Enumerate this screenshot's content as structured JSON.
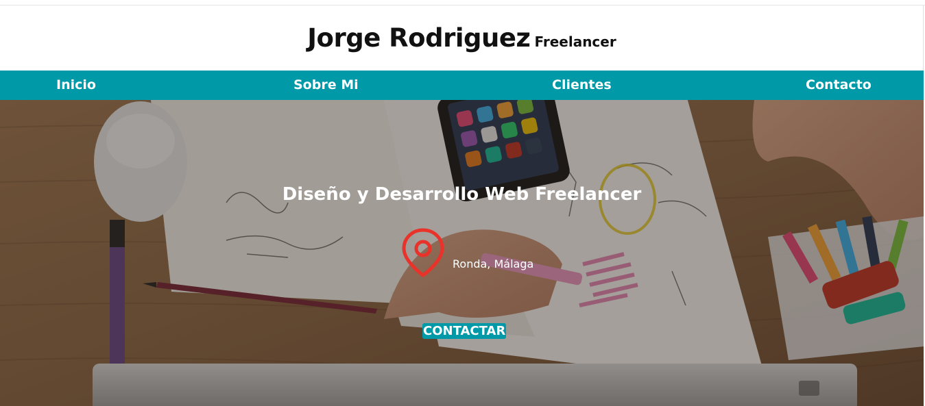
{
  "header": {
    "name": "Jorge Rodriguez",
    "role": "Freelancer"
  },
  "nav": {
    "items": [
      {
        "label": "Inicio"
      },
      {
        "label": "Sobre Mi"
      },
      {
        "label": "Clientes"
      },
      {
        "label": "Contacto"
      }
    ]
  },
  "hero": {
    "title": "Diseño y Desarrollo Web Freelancer",
    "location": "Ronda, Málaga",
    "cta_label": "CONTACTAR"
  },
  "colors": {
    "accent": "#0099a8",
    "pin": "#e8322a",
    "text_dark": "#111111"
  },
  "icons": {
    "location": "map-pin-icon"
  }
}
